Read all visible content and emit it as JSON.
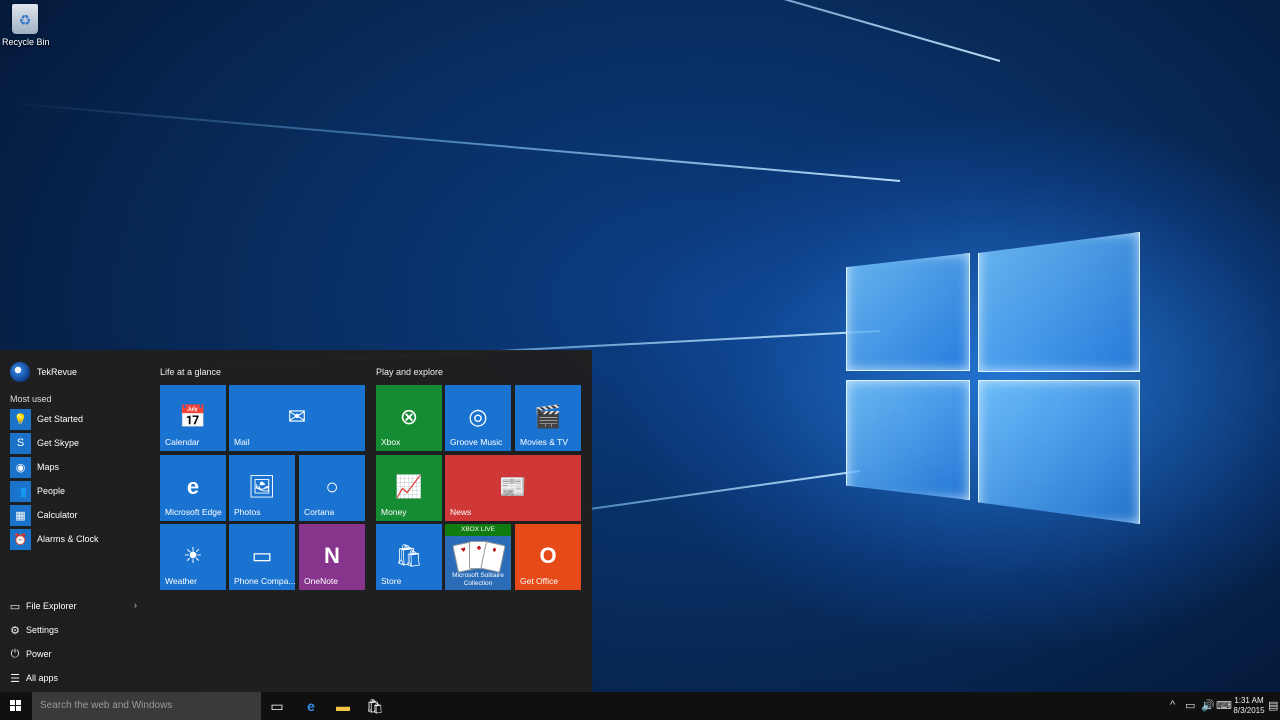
{
  "desktop": {
    "recycle_bin_label": "Recycle Bin"
  },
  "start_menu": {
    "user_name": "TekRevue",
    "most_used_heading": "Most used",
    "most_used": [
      {
        "label": "Get Started",
        "icon": "lightbulb-icon"
      },
      {
        "label": "Get Skype",
        "icon": "skype-icon"
      },
      {
        "label": "Maps",
        "icon": "maps-icon"
      },
      {
        "label": "People",
        "icon": "people-icon"
      },
      {
        "label": "Calculator",
        "icon": "calculator-icon"
      },
      {
        "label": "Alarms & Clock",
        "icon": "alarm-clock-icon"
      }
    ],
    "bottom_items": [
      {
        "label": "File Explorer",
        "icon": "folder-icon"
      },
      {
        "label": "Settings",
        "icon": "gear-icon"
      },
      {
        "label": "Power",
        "icon": "power-icon"
      },
      {
        "label": "All apps",
        "icon": "list-icon"
      }
    ],
    "groups": [
      {
        "title": "Life at a glance",
        "tiles": [
          {
            "label": "Calendar",
            "icon": "calendar-icon"
          },
          {
            "label": "Mail",
            "icon": "mail-icon"
          },
          {
            "label": "Microsoft Edge",
            "icon": "edge-icon"
          },
          {
            "label": "Photos",
            "icon": "photos-icon"
          },
          {
            "label": "Cortana",
            "icon": "cortana-icon"
          },
          {
            "label": "Weather",
            "icon": "weather-icon"
          },
          {
            "label": "Phone Compa...",
            "icon": "phone-companion-icon"
          },
          {
            "label": "OneNote",
            "icon": "onenote-icon"
          }
        ]
      },
      {
        "title": "Play and explore",
        "tiles": [
          {
            "label": "Xbox",
            "icon": "xbox-icon"
          },
          {
            "label": "Groove Music",
            "icon": "music-icon"
          },
          {
            "label": "Movies & TV",
            "icon": "movies-icon"
          },
          {
            "label": "Money",
            "icon": "money-icon"
          },
          {
            "label": "News",
            "icon": "news-icon"
          },
          {
            "label": "Store",
            "icon": "store-icon"
          },
          {
            "label": "Microsoft Solitaire Collection",
            "badge": "XBOX LIVE",
            "icon": "solitaire-icon"
          },
          {
            "label": "Get Office",
            "icon": "office-icon"
          }
        ]
      }
    ]
  },
  "taskbar": {
    "search_placeholder": "Search the web and Windows",
    "time": "1:31 AM",
    "date": "8/3/2015"
  },
  "colors": {
    "tile_blue": "#1a73d1",
    "tile_green": "#158b33",
    "tile_red": "#d03837",
    "tile_orange": "#e64a19",
    "tile_purple": "#87348c",
    "start_bg": "#1f1f1f",
    "taskbar_bg": "#101010"
  }
}
